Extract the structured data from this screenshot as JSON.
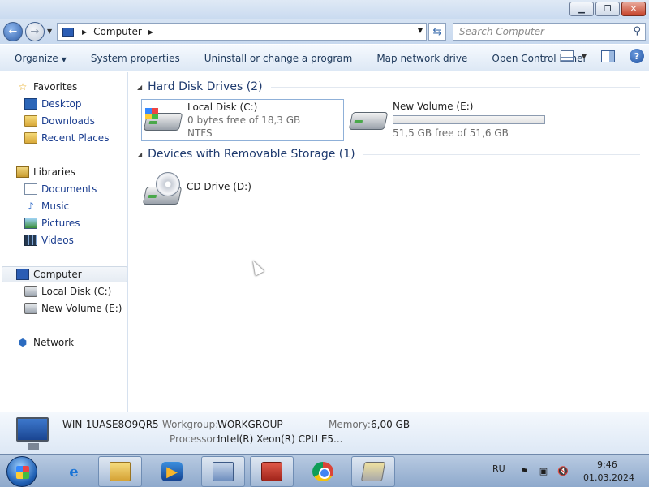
{
  "window": {
    "minimize_glyph": "▁",
    "maximize_glyph": "❐",
    "close_glyph": "✕"
  },
  "address": {
    "back_glyph": "←",
    "forward_glyph": "→",
    "crumb_separator": "▶",
    "crumb": "Computer",
    "trailing_separator": "▶",
    "dropdown_glyph": "▼",
    "refresh_glyph": "⇆",
    "search_placeholder": "Search Computer",
    "search_glyph": "⚲"
  },
  "toolbar": {
    "organize": "Organize",
    "organize_arrow": "▼",
    "items": [
      "System properties",
      "Uninstall or change a program",
      "Map network drive",
      "Open Control Panel"
    ],
    "view_dropdown_glyph": "▼",
    "help_glyph": "?"
  },
  "nav": {
    "favorites": {
      "label": "Favorites",
      "icon": "star-icon",
      "items": [
        "Desktop",
        "Downloads",
        "Recent Places"
      ]
    },
    "libraries": {
      "label": "Libraries",
      "icon": "library-icon",
      "items": [
        "Documents",
        "Music",
        "Pictures",
        "Videos"
      ]
    },
    "computer": {
      "label": "Computer",
      "icon": "computer-icon",
      "items": [
        "Local Disk (C:)",
        "New Volume (E:)"
      ]
    },
    "network": {
      "label": "Network",
      "icon": "network-icon"
    },
    "star_glyph": "☆",
    "music_glyph": "♪",
    "network_glyph": "⬢"
  },
  "content": {
    "hdd_header": "Hard Disk Drives (2)",
    "removable_header": "Devices with Removable Storage (1)",
    "collapse_glyph": "◢",
    "drives": [
      {
        "name": "Local Disk (C:)",
        "free": "0 bytes free of 18,3 GB",
        "fs": "NTFS",
        "used_fraction": 1.0
      },
      {
        "name": "New Volume (E:)",
        "free": "51,5 GB free of 51,6 GB",
        "used_fraction": 0.002
      }
    ],
    "removable": [
      {
        "name": "CD Drive (D:)"
      }
    ]
  },
  "details": {
    "computer_name": "WIN-1UASE8O9QR5",
    "workgroup_label": "Workgroup:",
    "workgroup": "WORKGROUP",
    "memory_label": "Memory:",
    "memory": "6,00 GB",
    "processor_label": "Processor:",
    "processor": "Intel(R) Xeon(R) CPU E5..."
  },
  "taskbar": {
    "ie_glyph": "e",
    "media_glyph": "▶",
    "language": "RU",
    "time": "9:46",
    "date": "01.03.2024",
    "flag_glyph": "⚑",
    "network_glyph": "▣",
    "volume_glyph": "🔇"
  }
}
